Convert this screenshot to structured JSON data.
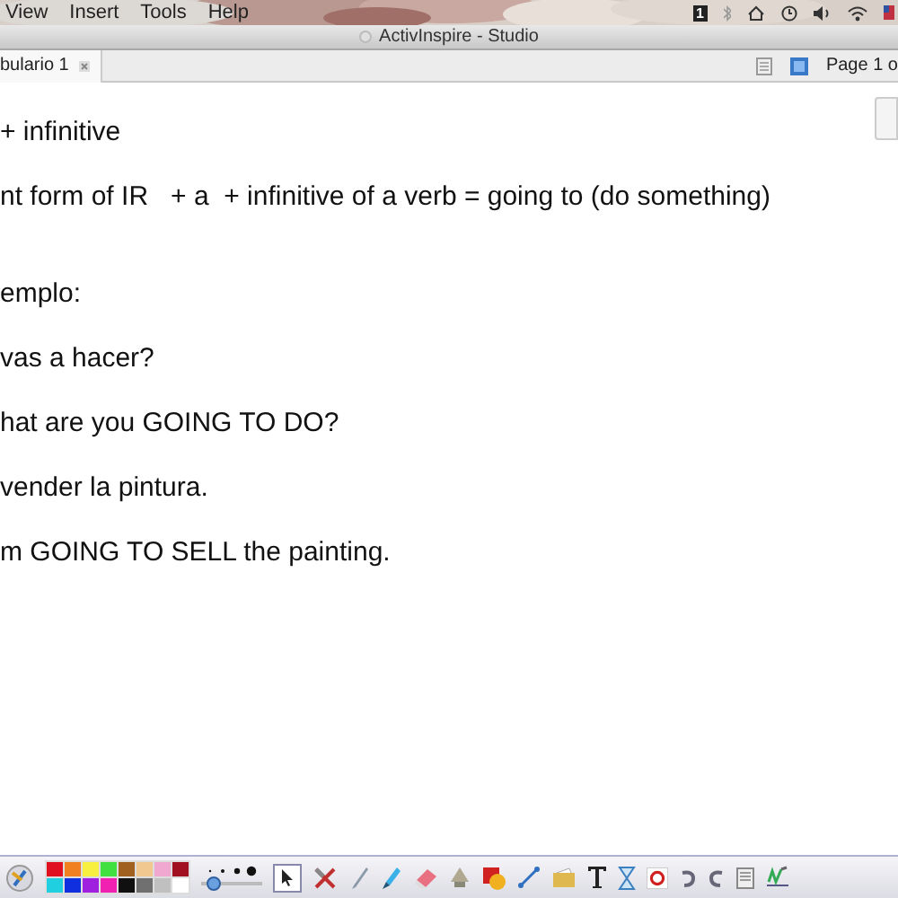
{
  "menu_bar": {
    "items": [
      "View",
      "Insert",
      "Tools",
      "Help"
    ],
    "badge": "1"
  },
  "window": {
    "title": "ActivInspire - Studio"
  },
  "tab": {
    "label": "bulario 1",
    "selected": true
  },
  "page_indicator": "Page 1 o",
  "lines": [
    "+ infinitive",
    "nt form of IR   + a  + infinitive of a verb = going to (do something)",
    "emplo:",
    "vas a hacer?",
    "hat are you GOING TO DO?",
    "vender la pintura.",
    "m GOING TO SELL the painting."
  ],
  "palette": [
    {
      "color": "#e01020"
    },
    {
      "color": "#f08020"
    },
    {
      "color": "#f8f040"
    },
    {
      "color": "#40e040"
    },
    {
      "color": "#a06020"
    },
    {
      "color": "#f0c890"
    },
    {
      "color": "#f0a8d0"
    },
    {
      "color": "#a01020"
    },
    {
      "color": "#20d0e0"
    },
    {
      "color": "#1030e0"
    },
    {
      "color": "#a020e0"
    },
    {
      "color": "#f020b0"
    },
    {
      "color": "#101010"
    },
    {
      "color": "#707070"
    },
    {
      "color": "#c0c0c0"
    },
    {
      "color": "#ffffff"
    }
  ],
  "pen_width": {
    "level": 0.1
  }
}
